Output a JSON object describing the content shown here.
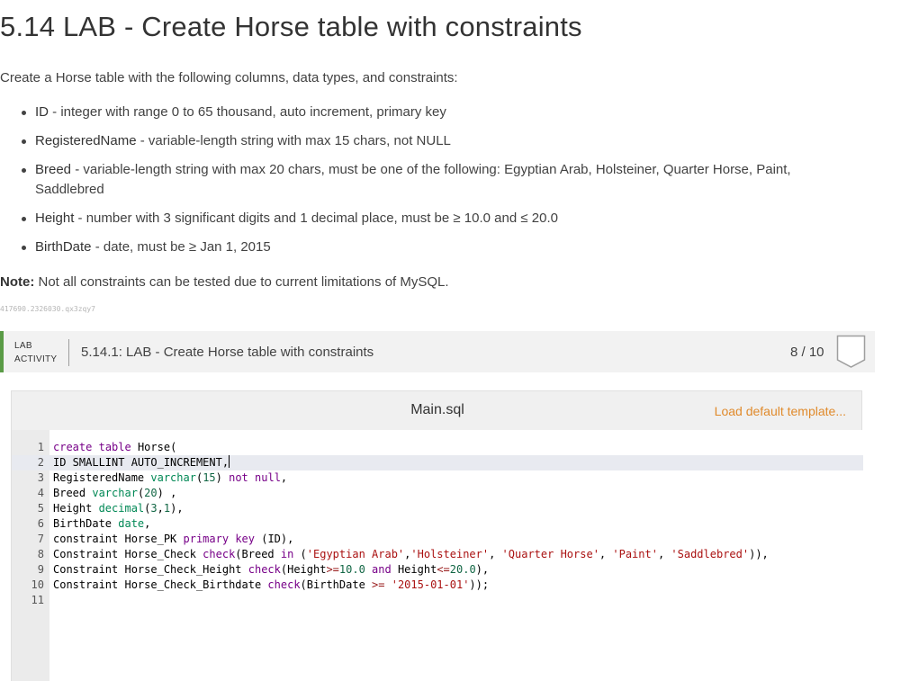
{
  "page": {
    "title": "5.14 LAB - Create Horse table with constraints",
    "intro": "Create a Horse table with the following columns, data types, and constraints:",
    "requirements": [
      {
        "name": "ID",
        "desc": " - integer with range 0 to 65 thousand, auto increment, primary key"
      },
      {
        "name": "RegisteredName",
        "desc": " - variable-length string with max 15 chars, not NULL"
      },
      {
        "name": "Breed",
        "desc": " - variable-length string with max 20 chars, must be one of the following: Egyptian Arab, Holsteiner, Quarter Horse, Paint, Saddlebred"
      },
      {
        "name": "Height",
        "desc": " - number with 3 significant digits and 1 decimal place, must be ≥ 10.0 and ≤ 20.0"
      },
      {
        "name": "BirthDate",
        "desc": " - date, must be ≥ Jan 1, 2015"
      }
    ],
    "note_label": "Note:",
    "note_text": " Not all constraints can be tested due to current limitations of MySQL.",
    "activity_id": "417690.2326030.qx3zqy7"
  },
  "lab": {
    "tag_line1": "LAB",
    "tag_line2": "ACTIVITY",
    "title": "5.14.1: LAB - Create Horse table with constraints",
    "score": "8 / 10",
    "accent_color": "#5a9b46"
  },
  "editor": {
    "file_name": "Main.sql",
    "load_template": "Load default template...",
    "active_line": 2,
    "lines": [
      "create table Horse(",
      "ID SMALLINT AUTO_INCREMENT,",
      "RegisteredName varchar(15) not null,",
      "Breed varchar(20) ,",
      "Height decimal(3,1),",
      "BirthDate date,",
      "constraint Horse_PK primary key (ID),",
      "Constraint Horse_Check check(Breed in ('Egyptian Arab','Holsteiner', 'Quarter Horse', 'Paint', 'Saddlebred')),",
      "Constraint Horse_Check_Height check(Height>=10.0 and Height<=20.0),",
      "Constraint Horse_Check_Birthdate check(BirthDate >= '2015-01-01'));",
      ""
    ]
  }
}
